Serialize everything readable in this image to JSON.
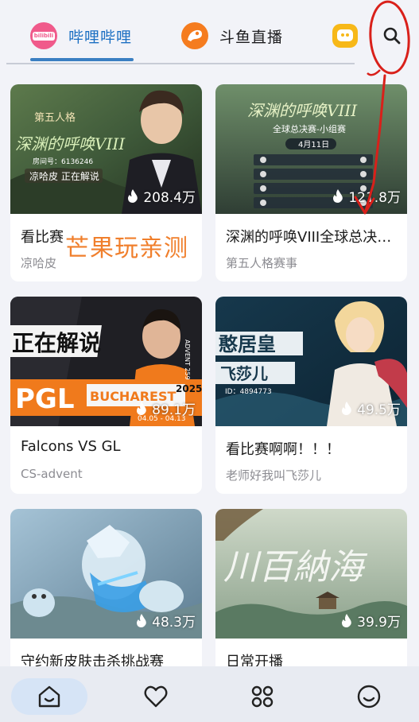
{
  "tabs": [
    {
      "label": "哔哩哔哩",
      "logo_text": "bilibili",
      "icon": "bilibili-logo-icon",
      "active": true
    },
    {
      "label": "斗鱼直播",
      "icon": "douyu-logo-icon",
      "active": false
    },
    {
      "label": "",
      "icon": "huya-logo-icon",
      "active": false
    }
  ],
  "search_icon": "search-icon",
  "colors": {
    "accent": "#3a7fc2",
    "tab_active_text": "#1b6fc2",
    "watermark": "#f07f2c",
    "annotation": "#d9201a"
  },
  "cards": [
    {
      "title": "看比赛",
      "sub": "凉哈皮",
      "heat": "208.4万"
    },
    {
      "title": "深渊的呼唤VIII全球总决赛-小组赛",
      "sub": "第五人格赛事",
      "heat": "121.8万"
    },
    {
      "title": "Falcons VS GL",
      "sub": "CS-advent",
      "heat": "89.1万"
    },
    {
      "title": "看比赛啊啊！！！",
      "sub": "老师好我叫飞莎儿",
      "heat": "49.5万"
    },
    {
      "title": "守约新皮肤击杀挑战赛",
      "sub": "",
      "heat": "48.3万"
    },
    {
      "title": "日常开播",
      "sub": "",
      "heat": "39.9万"
    }
  ],
  "thumb_text": {
    "c1_game": "第五人格",
    "c1_banner": "深渊的呼唤VIII",
    "c1_room": "房间号：6136246",
    "c1_caster": "凉哈皮 正在解说",
    "c2_banner": "深渊的呼唤VIII",
    "c2_sub": "全球总决赛-小组赛",
    "c2_date": "4月11日",
    "c3_live": "正在解说",
    "c3_pgl": "PGL",
    "c3_city": "BUCHAREST",
    "c3_year": "2025",
    "c3_advent": "ADVENT 259",
    "c3_dates": "04.05 - 04.13",
    "c4_name": "飞莎儿",
    "c4_title": "憨居皇",
    "c4_room": "ID：4894773",
    "c6_calligraphy": "川百納海"
  },
  "watermark": "芒果玩亲测",
  "nav": [
    {
      "name": "home",
      "icon": "home-icon",
      "active": true
    },
    {
      "name": "favorites",
      "icon": "heart-icon",
      "active": false
    },
    {
      "name": "apps",
      "icon": "apps-grid-icon",
      "active": false
    },
    {
      "name": "profile",
      "icon": "smile-icon",
      "active": false
    }
  ]
}
